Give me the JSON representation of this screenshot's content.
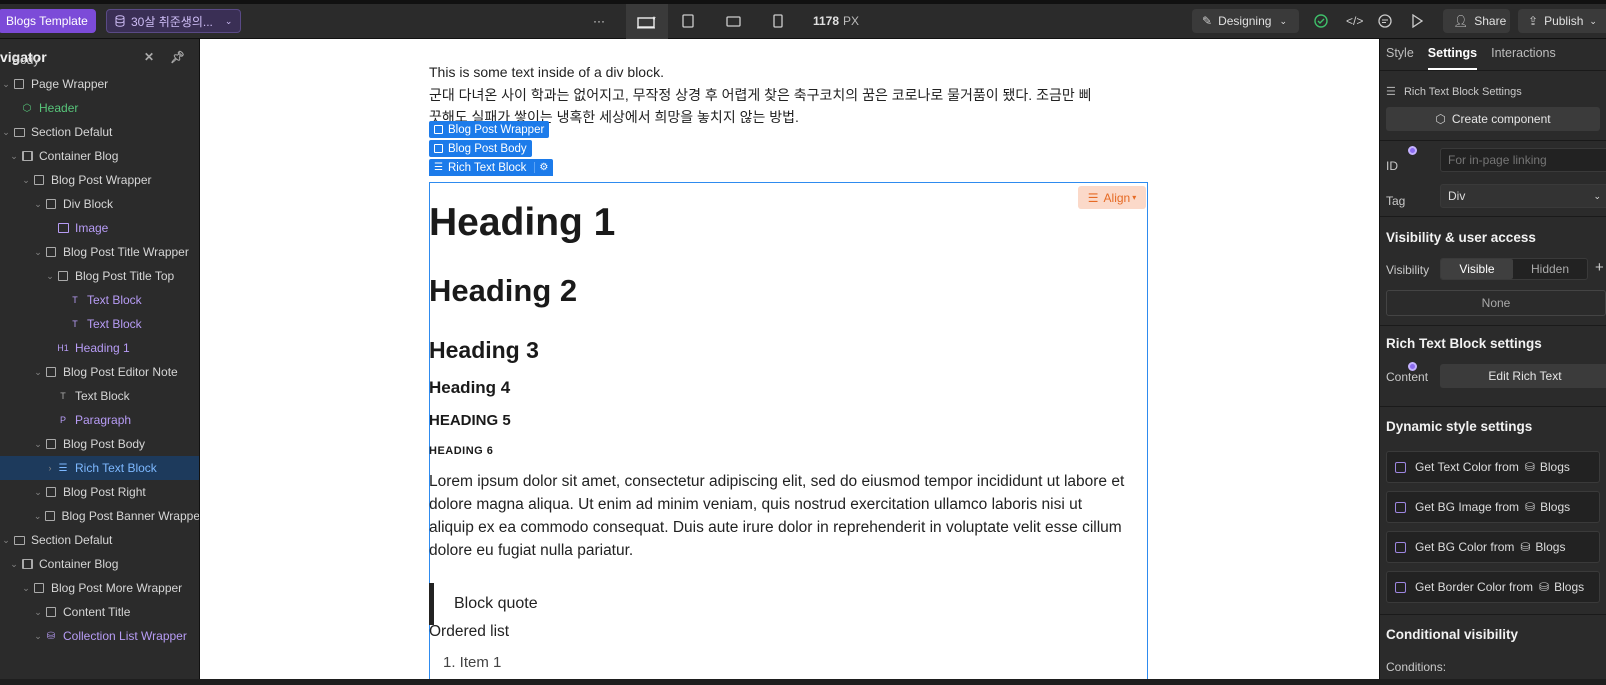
{
  "topbar": {
    "template_label": "Blogs Template",
    "collection_label": "30살 취준생의...",
    "more_label": "···",
    "width_value": "1178",
    "width_unit": "PX",
    "mode_label": "Designing",
    "share_label": "Share",
    "publish_label": "Publish"
  },
  "navigator": {
    "title": "vigator",
    "items": [
      {
        "label": "Body",
        "depth": 0,
        "icon": "none",
        "color": "default"
      },
      {
        "label": "Page Wrapper",
        "depth": 0,
        "icon": "box",
        "color": "default"
      },
      {
        "label": "Header",
        "depth": 1,
        "icon": "component-icon",
        "color": "green"
      },
      {
        "label": "Section Defalut",
        "depth": 0,
        "icon": "section-icon",
        "color": "default"
      },
      {
        "label": "Container Blog",
        "depth": 1,
        "icon": "container-icon",
        "color": "default"
      },
      {
        "label": "Blog Post Wrapper",
        "depth": 2,
        "icon": "box",
        "color": "default"
      },
      {
        "label": "Div Block",
        "depth": 3,
        "icon": "box",
        "color": "default"
      },
      {
        "label": "Image",
        "depth": 4,
        "icon": "image-icon",
        "color": "purple"
      },
      {
        "label": "Blog Post Title Wrapper",
        "depth": 3,
        "icon": "box",
        "color": "default"
      },
      {
        "label": "Blog Post Title Top",
        "depth": 4,
        "icon": "box",
        "color": "default"
      },
      {
        "label": "Text Block",
        "depth": 5,
        "icon": "T",
        "color": "purple"
      },
      {
        "label": "Text Block",
        "depth": 5,
        "icon": "T",
        "color": "purple"
      },
      {
        "label": "Heading 1",
        "depth": 4,
        "icon": "H1",
        "color": "purple"
      },
      {
        "label": "Blog Post Editor Note",
        "depth": 3,
        "icon": "box",
        "color": "default"
      },
      {
        "label": "Text Block",
        "depth": 4,
        "icon": "T",
        "color": "default"
      },
      {
        "label": "Paragraph",
        "depth": 4,
        "icon": "P",
        "color": "purple"
      },
      {
        "label": "Blog Post Body",
        "depth": 3,
        "icon": "box",
        "color": "default"
      },
      {
        "label": "Rich Text Block",
        "depth": 4,
        "icon": "rich-text-icon",
        "color": "selected"
      },
      {
        "label": "Blog Post Right",
        "depth": 3,
        "icon": "box",
        "color": "default"
      },
      {
        "label": "Blog Post Banner Wrappe",
        "depth": 3,
        "icon": "box",
        "color": "default"
      },
      {
        "label": "Section Defalut",
        "depth": 0,
        "icon": "section-icon",
        "color": "default"
      },
      {
        "label": "Container Blog",
        "depth": 1,
        "icon": "container-icon",
        "color": "default"
      },
      {
        "label": "Blog Post More Wrapper",
        "depth": 2,
        "icon": "box",
        "color": "default"
      },
      {
        "label": "Content Title",
        "depth": 3,
        "icon": "box",
        "color": "default"
      },
      {
        "label": "Collection List Wrapper",
        "depth": 3,
        "icon": "database-icon",
        "color": "purple"
      }
    ]
  },
  "canvas": {
    "intro_line1": "This is some text inside of a div block.",
    "intro_line2": "군대 다녀온 사이 학과는 없어지고, 무작정 상경 후 어렵게 찾은 축구코치의 꿈은 코로나로 물거품이 됐다. 조금만 삐",
    "intro_line3": "끗해도 실패가 쌓이는 냉혹한 세상에서 희망을 놓치지 않는 방법.",
    "badge_wrapper": "Blog Post Wrapper",
    "badge_body": "Blog Post Body",
    "badge_rich": "Rich Text Block",
    "align_label": "Align",
    "h1": "Heading 1",
    "h2": "Heading 2",
    "h3": "Heading 3",
    "h4": "Heading 4",
    "h5": "HEADING 5",
    "h6": "HEADING 6",
    "paragraph": "Lorem ipsum dolor sit amet, consectetur adipiscing elit, sed do eiusmod tempor incididunt ut labore et dolore magna aliqua. Ut enim ad minim veniam, quis nostrud exercitation ullamco laboris nisi ut aliquip ex ea commodo consequat. Duis aute irure dolor in reprehenderit in voluptate velit esse cillum dolore eu fugiat nulla pariatur.",
    "blockquote": "Block quote",
    "ordered_list_label": "Ordered list",
    "list_item_1": "1. Item 1"
  },
  "panel": {
    "tabs": [
      "Style",
      "Settings",
      "Interactions"
    ],
    "active_tab": "Settings",
    "element_settings_label": "Rich Text Block Settings",
    "create_component_label": "Create component",
    "id_label": "ID",
    "id_placeholder": "For in-page linking",
    "tag_label": "Tag",
    "tag_value": "Div",
    "visibility_title": "Visibility & user access",
    "visibility_label": "Visibility",
    "visible_label": "Visible",
    "hidden_label": "Hidden",
    "none_label": "None",
    "rich_settings_title": "Rich Text Block settings",
    "content_label": "Content",
    "edit_rich_text_label": "Edit Rich Text",
    "dynamic_title": "Dynamic style settings",
    "dynamic_items": [
      {
        "prefix": "Get Text Color from",
        "source": "Blogs"
      },
      {
        "prefix": "Get BG Image from",
        "source": "Blogs"
      },
      {
        "prefix": "Get BG Color from",
        "source": "Blogs"
      },
      {
        "prefix": "Get Border Color from",
        "source": "Blogs"
      }
    ],
    "conditional_title": "Conditional visibility",
    "conditions_label": "Conditions:"
  },
  "colors": {
    "accent_blue": "#1c7bea",
    "accent_purple": "#7c4bd8",
    "align_orange": "#e66a25",
    "component_green": "#57c57a"
  }
}
